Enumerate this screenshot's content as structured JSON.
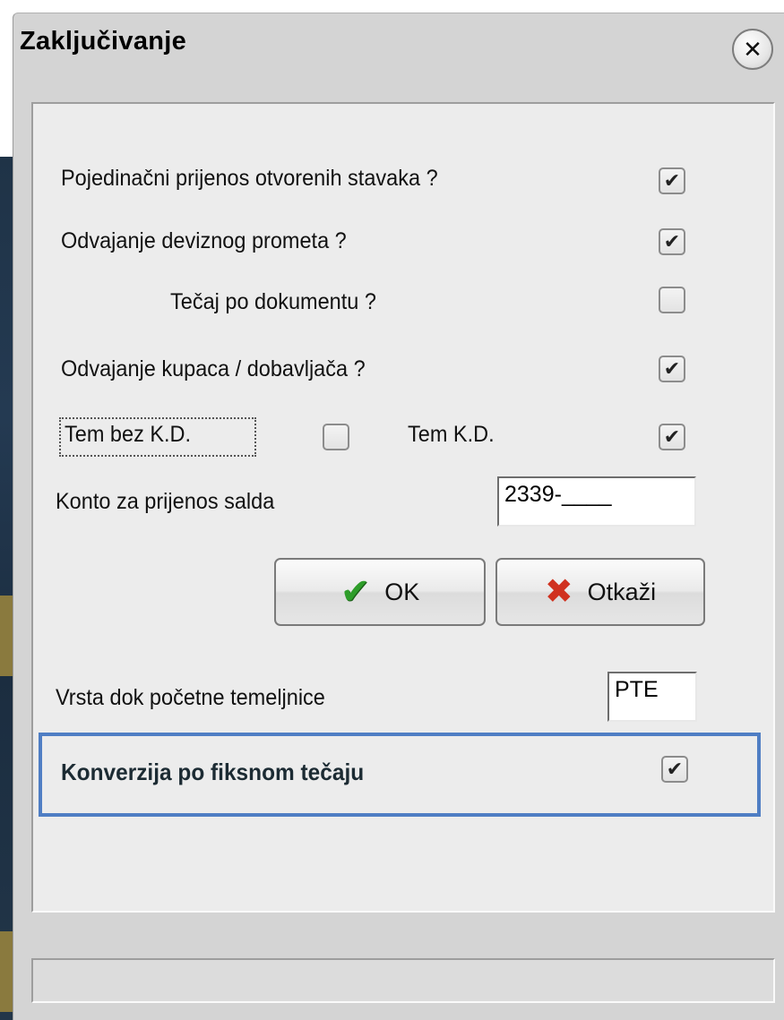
{
  "window": {
    "title": "Zaključivanje",
    "close_icon": "close-circle-icon",
    "close_glyph": "✕"
  },
  "options": {
    "pojedinacni_label": "Pojedinačni prijenos otvorenih stavaka ?",
    "pojedinacni_checked": true,
    "devizni_label": "Odvajanje deviznog prometa ?",
    "devizni_checked": true,
    "tecaj_label": "Tečaj po dokumentu ?",
    "tecaj_checked": false,
    "kupci_label": "Odvajanje kupaca / dobavljača ?",
    "kupci_checked": true,
    "tem_bez_kd_label": "Tem bez K.D.",
    "tem_bez_kd_checked": false,
    "tem_kd_label": "Tem K.D.",
    "tem_kd_checked": true
  },
  "konto": {
    "label": "Konto za prijenos salda",
    "value": "2339-____"
  },
  "buttons": {
    "ok_label": "OK",
    "ok_icon": "green-check-icon",
    "cancel_label": "Otkaži",
    "cancel_icon": "red-x-icon"
  },
  "vrsta": {
    "label": "Vrsta dok početne temeljnice",
    "value": "PTE"
  },
  "konverzija": {
    "label": "Konverzija po fiksnom tečaju",
    "checked": true,
    "highlight_color": "#4f7ec4"
  }
}
